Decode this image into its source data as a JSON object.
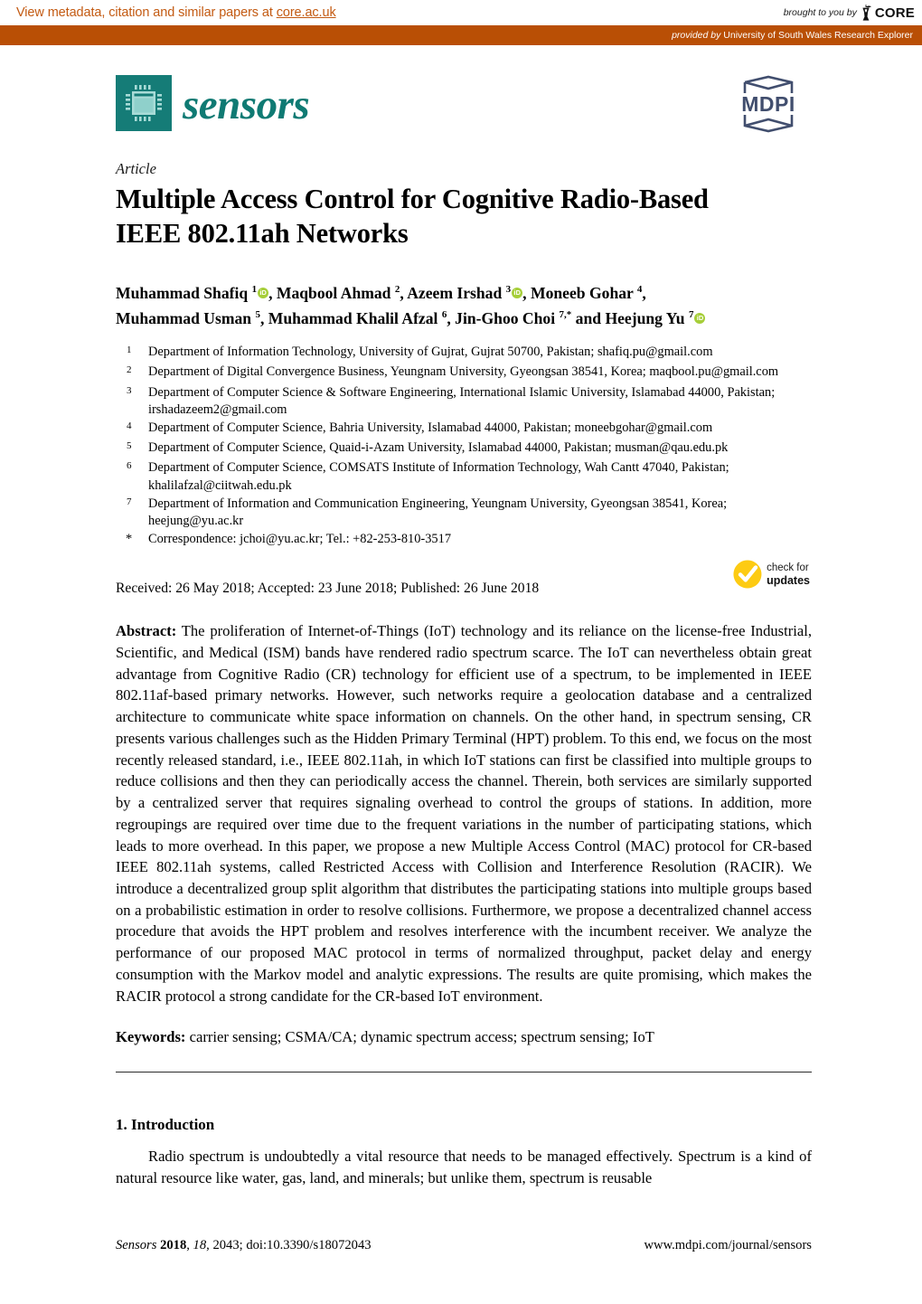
{
  "core_banner": {
    "metadata_text": "View metadata, citation and similar papers at ",
    "metadata_link": "core.ac.uk",
    "brought_by": "brought to you by",
    "core_word": "CORE",
    "provided_by_label": "provided by",
    "provided_by_source": "University of South Wales Research Explorer",
    "bar_color": "#b94f05",
    "text_color": "#c35a12"
  },
  "journal": {
    "name": "sensors",
    "logo_color": "#157c77",
    "publisher": "MDPI",
    "publisher_color": "#414e6e"
  },
  "article": {
    "kind": "Article",
    "title_line1": "Multiple Access Control for Cognitive Radio-Based",
    "title_line2": "IEEE 802.11ah Networks"
  },
  "authors": {
    "line1": [
      {
        "name": "Muhammad Shafiq",
        "sup": "1",
        "orcid": true,
        "sep": ", "
      },
      {
        "name": "Maqbool Ahmad",
        "sup": "2",
        "orcid": false,
        "sep": ", "
      },
      {
        "name": "Azeem Irshad",
        "sup": "3",
        "orcid": true,
        "sep": ", "
      },
      {
        "name": "Moneeb Gohar",
        "sup": "4",
        "orcid": false,
        "sep": ","
      }
    ],
    "line2": [
      {
        "name": "Muhammad Usman",
        "sup": "5",
        "orcid": false,
        "sep": ", "
      },
      {
        "name": "Muhammad Khalil Afzal",
        "sup": "6",
        "orcid": false,
        "sep": ", "
      },
      {
        "name": "Jin-Ghoo Choi",
        "sup": "7,*",
        "orcid": false,
        "sep": " and "
      },
      {
        "name": "Heejung Yu",
        "sup": "7",
        "orcid": true,
        "sep": ""
      }
    ],
    "orcid_icon_label": "iD",
    "orcid_color": "#a6ce39"
  },
  "affiliations": [
    {
      "mark": "1",
      "text": "Department of Information Technology, University of Gujrat, Gujrat 50700, Pakistan; shafiq.pu@gmail.com"
    },
    {
      "mark": "2",
      "text": "Department of Digital Convergence Business, Yeungnam University, Gyeongsan 38541, Korea; maqbool.pu@gmail.com"
    },
    {
      "mark": "3",
      "text": "Department of Computer Science & Software Engineering, International Islamic University, Islamabad 44000, Pakistan; irshadazeem2@gmail.com"
    },
    {
      "mark": "4",
      "text": "Department of Computer Science, Bahria University, Islamabad 44000, Pakistan; moneebgohar@gmail.com"
    },
    {
      "mark": "5",
      "text": "Department of Computer Science, Quaid-i-Azam University, Islamabad 44000, Pakistan; musman@qau.edu.pk"
    },
    {
      "mark": "6",
      "text": "Department of Computer Science, COMSATS Institute of Information Technology, Wah Cantt 47040, Pakistan; khalilafzal@ciitwah.edu.pk"
    },
    {
      "mark": "7",
      "text": "Department of Information and Communication Engineering, Yeungnam University, Gyeongsan 38541, Korea; heejung@yu.ac.kr"
    },
    {
      "mark": "*",
      "text": "Correspondence: jchoi@yu.ac.kr; Tel.: +82-253-810-3517"
    }
  ],
  "dates": {
    "text": "Received: 26 May 2018; Accepted: 23 June 2018; Published: 26 June 2018"
  },
  "check_for_updates": {
    "line1": "check for",
    "line2": "updates",
    "color": "#fdcb13"
  },
  "abstract": {
    "label": "Abstract:",
    "body": " The proliferation of Internet-of-Things (IoT) technology and its reliance on the license-free Industrial, Scientific, and Medical (ISM) bands have rendered radio spectrum scarce. The IoT can nevertheless obtain great advantage from Cognitive Radio (CR) technology for efficient use of a spectrum, to be implemented in IEEE 802.11af-based primary networks. However, such networks require a geolocation database and a centralized architecture to communicate white space information on channels. On the other hand, in spectrum sensing, CR presents various challenges such as the Hidden Primary Terminal (HPT) problem. To this end, we focus on the most recently released standard, i.e., IEEE 802.11ah, in which IoT stations can first be classified into multiple groups to reduce collisions and then they can periodically access the channel. Therein, both services are similarly supported by a centralized server that requires signaling overhead to control the groups of stations. In addition, more regroupings are required over time due to the frequent variations in the number of participating stations, which leads to more overhead. In this paper, we propose a new Multiple Access Control (MAC) protocol for CR-based IEEE 802.11ah systems, called Restricted Access with Collision and Interference Resolution (RACIR). We introduce a decentralized group split algorithm that distributes the participating stations into multiple groups based on a probabilistic estimation in order to resolve collisions. Furthermore, we propose a decentralized channel access procedure that avoids the HPT problem and resolves interference with the incumbent receiver. We analyze the performance of our proposed MAC protocol in terms of normalized throughput, packet delay and energy consumption with the Markov model and analytic expressions. The results are quite promising, which makes the RACIR protocol a strong candidate for the CR-based IoT environment."
  },
  "keywords": {
    "label": "Keywords:",
    "body": " carrier sensing; CSMA/CA; dynamic spectrum access; spectrum sensing; IoT"
  },
  "section": {
    "heading": "1. Introduction",
    "paragraph": "Radio spectrum is undoubtedly a vital resource that needs to be managed effectively. Spectrum is a kind of natural resource like water, gas, land, and minerals; but unlike them, spectrum is reusable"
  },
  "footer": {
    "journal": "Sensors",
    "year": "2018",
    "volume": "18",
    "article_no": "2043",
    "doi": "doi:10.3390/s18072043",
    "url": "www.mdpi.com/journal/sensors"
  }
}
